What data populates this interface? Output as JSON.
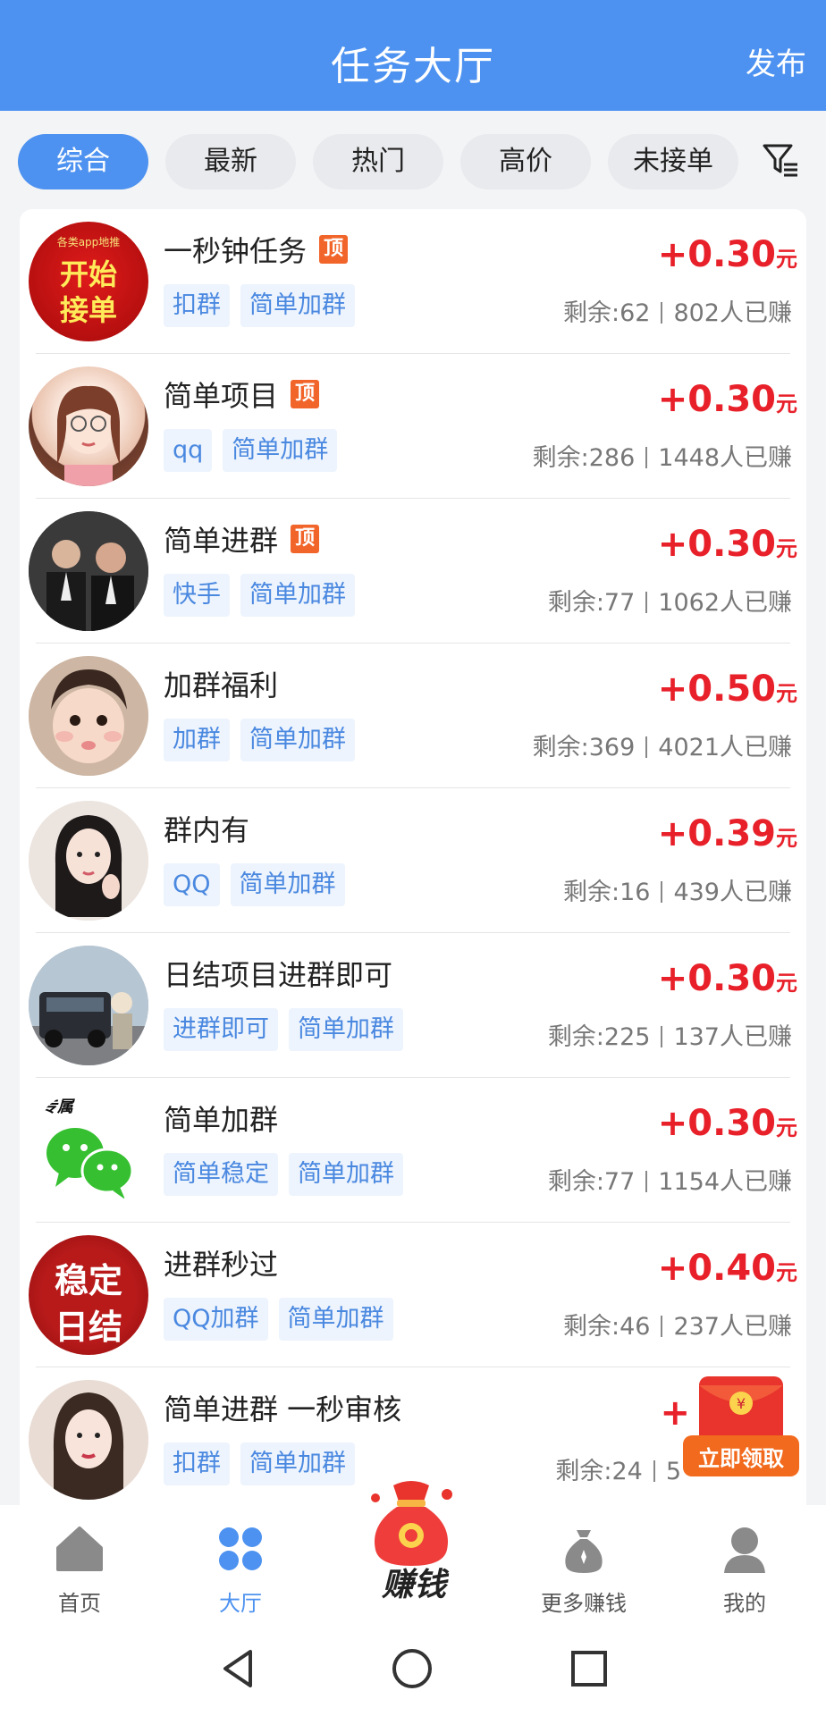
{
  "header": {
    "title": "任务大厅",
    "publish": "发布"
  },
  "filters": {
    "chips": [
      {
        "label": "综合",
        "active": true
      },
      {
        "label": "最新",
        "active": false
      },
      {
        "label": "热门",
        "active": false
      },
      {
        "label": "高价",
        "active": false
      },
      {
        "label": "未接单",
        "active": false
      }
    ],
    "filter_icon": "filter-icon"
  },
  "tasks": [
    {
      "title": "一秒钟任务",
      "top": true,
      "top_label": "顶",
      "tags": [
        "扣群",
        "简单加群"
      ],
      "price": "+0.30",
      "unit": "元",
      "remaining": "剩余:62",
      "earned": "802人已赚",
      "avatar_text": [
        "开始",
        "接单"
      ],
      "avatar_small": "各类app地推"
    },
    {
      "title": "简单项目",
      "top": true,
      "top_label": "顶",
      "tags": [
        "qq",
        "简单加群"
      ],
      "price": "+0.30",
      "unit": "元",
      "remaining": "剩余:286",
      "earned": "1448人已赚"
    },
    {
      "title": "简单进群",
      "top": true,
      "top_label": "顶",
      "tags": [
        "快手",
        "简单加群"
      ],
      "price": "+0.30",
      "unit": "元",
      "remaining": "剩余:77",
      "earned": "1062人已赚"
    },
    {
      "title": "加群福利",
      "top": false,
      "tags": [
        "加群",
        "简单加群"
      ],
      "price": "+0.50",
      "unit": "元",
      "remaining": "剩余:369",
      "earned": "4021人已赚"
    },
    {
      "title": "群内有",
      "top": false,
      "tags": [
        "QQ",
        "简单加群"
      ],
      "price": "+0.39",
      "unit": "元",
      "remaining": "剩余:16",
      "earned": "439人已赚"
    },
    {
      "title": "日结项目进群即可",
      "top": false,
      "tags": [
        "进群即可",
        "简单加群"
      ],
      "price": "+0.30",
      "unit": "元",
      "remaining": "剩余:225",
      "earned": "137人已赚"
    },
    {
      "title": "简单加群",
      "top": false,
      "tags": [
        "简单稳定",
        "简单加群"
      ],
      "price": "+0.30",
      "unit": "元",
      "remaining": "剩余:77",
      "earned": "1154人已赚",
      "avatar_small": "专属"
    },
    {
      "title": "进群秒过",
      "top": false,
      "tags": [
        "QQ加群",
        "简单加群"
      ],
      "price": "+0.40",
      "unit": "元",
      "remaining": "剩余:46",
      "earned": "237人已赚",
      "avatar_text": [
        "稳定",
        "日结"
      ]
    },
    {
      "title": "简单进群 一秒审核",
      "top": false,
      "tags": [
        "扣群",
        "简单加群"
      ],
      "price": "+",
      "unit": "",
      "remaining": "剩余:24",
      "earned": "5"
    }
  ],
  "floating": {
    "label": "立即领取"
  },
  "tabbar": {
    "items": [
      {
        "label": "首页",
        "icon": "home-icon"
      },
      {
        "label": "大厅",
        "icon": "grid-icon",
        "active": true
      },
      {
        "label": "赚钱",
        "icon": "money-bag-icon"
      },
      {
        "label": "更多赚钱",
        "icon": "coin-bag-icon"
      },
      {
        "label": "我的",
        "icon": "user-icon"
      }
    ]
  },
  "system_nav": [
    "back-icon",
    "home-circle-icon",
    "recents-icon"
  ],
  "colors": {
    "primary": "#4d92f0",
    "price": "#e8202a",
    "tag_text": "#4a88e0",
    "tag_bg": "#edf4fd",
    "top_badge": "#f2652a"
  }
}
